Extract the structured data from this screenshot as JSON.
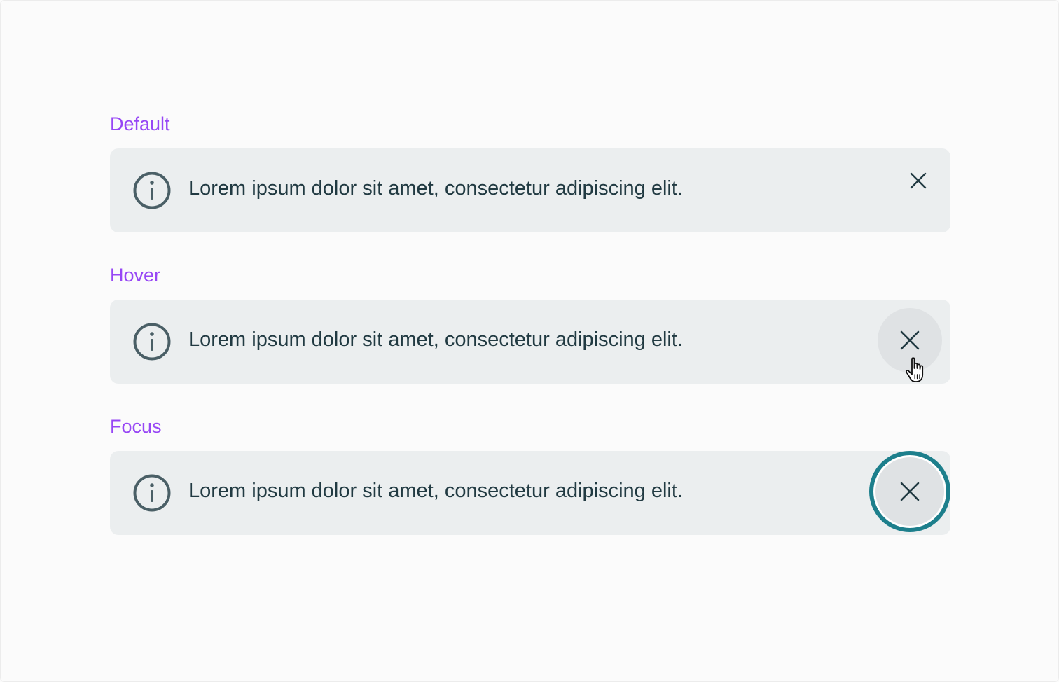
{
  "states": [
    {
      "label": "Default",
      "message": "Lorem ipsum dolor sit amet, consectetur adipiscing elit."
    },
    {
      "label": "Hover",
      "message": "Lorem ipsum dolor sit amet, consectetur adipiscing elit."
    },
    {
      "label": "Focus",
      "message": "Lorem ipsum dolor sit amet, consectetur adipiscing elit."
    }
  ],
  "icons": {
    "info": "info-icon",
    "close": "close-icon",
    "cursor": "pointer-hand-cursor"
  },
  "colors": {
    "state_label": "#9747f5",
    "banner_background": "#ebeeef",
    "text": "#213a42",
    "icon": "#4a5f66",
    "hover_background": "#dfe2e4",
    "focus_ring": "#1d7f8c"
  }
}
